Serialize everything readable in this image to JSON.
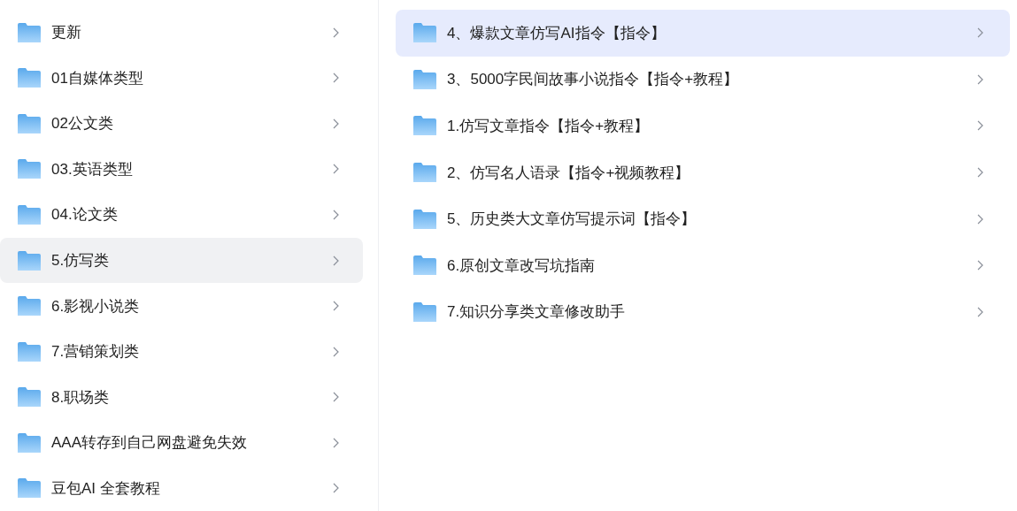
{
  "categories": [
    {
      "label": "更新",
      "selected": false
    },
    {
      "label": "01自媒体类型",
      "selected": false
    },
    {
      "label": "02公文类",
      "selected": false
    },
    {
      "label": "03.英语类型",
      "selected": false
    },
    {
      "label": "04.论文类",
      "selected": false
    },
    {
      "label": "5.仿写类",
      "selected": true
    },
    {
      "label": "6.影视小说类",
      "selected": false
    },
    {
      "label": "7.营销策划类",
      "selected": false
    },
    {
      "label": "8.职场类",
      "selected": false
    },
    {
      "label": "AAA转存到自己网盘避免失效",
      "selected": false
    },
    {
      "label": "豆包AI 全套教程",
      "selected": false
    }
  ],
  "folders": [
    {
      "label": "4、爆款文章仿写AI指令【指令】",
      "selected": true
    },
    {
      "label": "3、5000字民间故事小说指令【指令+教程】",
      "selected": false
    },
    {
      "label": "1.仿写文章指令【指令+教程】",
      "selected": false
    },
    {
      "label": "2、仿写名人语录【指令+视频教程】",
      "selected": false
    },
    {
      "label": "5、历史类大文章仿写提示词【指令】",
      "selected": false
    },
    {
      "label": "6.原创文章改写坑指南",
      "selected": false
    },
    {
      "label": "7.知识分享类文章修改助手",
      "selected": false
    }
  ]
}
